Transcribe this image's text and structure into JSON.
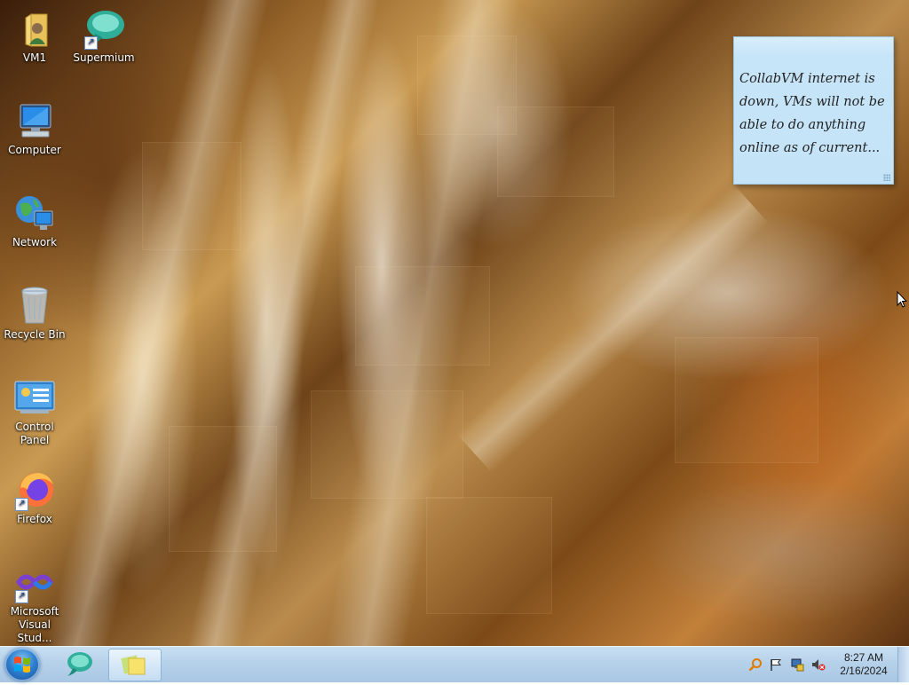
{
  "desktop_icons": [
    {
      "id": "vm1",
      "label": "VM1",
      "icon": "user-folder-icon"
    },
    {
      "id": "supermium",
      "label": "Supermium",
      "icon": "supermium-browser-icon",
      "shortcut": true
    },
    {
      "id": "computer",
      "label": "Computer",
      "icon": "computer-icon"
    },
    {
      "id": "network",
      "label": "Network",
      "icon": "network-icon"
    },
    {
      "id": "recycle",
      "label": "Recycle Bin",
      "icon": "recycle-bin-icon"
    },
    {
      "id": "control",
      "label": "Control Panel",
      "icon": "control-panel-icon"
    },
    {
      "id": "firefox",
      "label": "Firefox",
      "icon": "firefox-icon",
      "shortcut": true
    },
    {
      "id": "vs",
      "label": "Microsoft Visual Stud...",
      "label_line1": "Microsoft",
      "label_line2": "Visual Stud...",
      "icon": "visual-studio-icon",
      "shortcut": true
    }
  ],
  "sticky_note": {
    "text": "CollabVM internet is down, VMs will not be able to do anything online as of current..."
  },
  "taskbar": {
    "start_icon": "windows-start-orb",
    "pinned": [
      {
        "name": "supermium",
        "icon": "supermium-browser-icon"
      },
      {
        "name": "sticky-notes",
        "icon": "sticky-notes-icon",
        "active": true
      }
    ],
    "tray_icons": [
      "search-magnifier-icon",
      "action-center-flag-icon",
      "network-icon",
      "volume-muted-icon"
    ],
    "clock": {
      "time": "8:27 AM",
      "date": "2/16/2024"
    }
  },
  "colors": {
    "taskbar": "#b6d1ea",
    "sticky_note": "#c4e3f7"
  }
}
